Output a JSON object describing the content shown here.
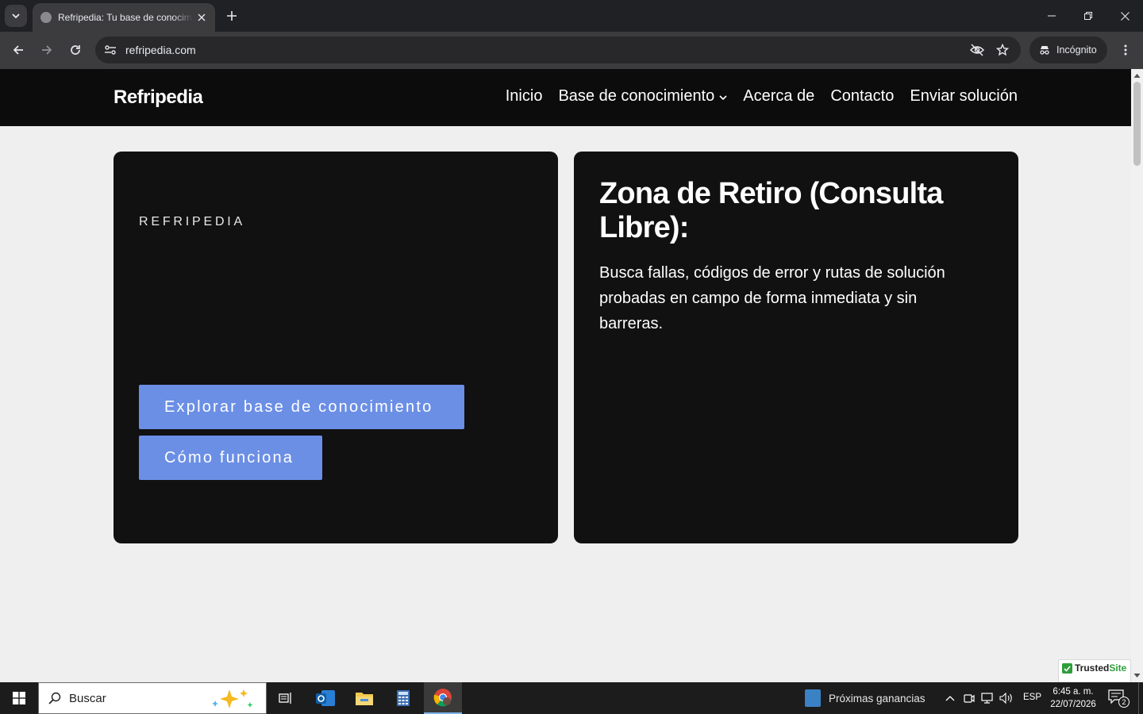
{
  "browser": {
    "tab_title": "Refripedia: Tu base de conocimiento",
    "url": "refripedia.com",
    "incognito_label": "Incógnito"
  },
  "site": {
    "brand": "Refripedia",
    "nav": [
      {
        "label": "Inicio"
      },
      {
        "label": "Base de conocimiento",
        "has_dropdown": true
      },
      {
        "label": "Acerca de"
      },
      {
        "label": "Contacto"
      },
      {
        "label": "Enviar solución"
      }
    ]
  },
  "hero_left": {
    "eyebrow": "REFRIPEDIA",
    "primary_button": "Explorar base de conocimiento",
    "secondary_button": "Cómo funciona"
  },
  "hero_right": {
    "title": "Zona de Retiro (Consulta Libre):",
    "text": "Busca fallas, códigos de error y rutas de solución probadas en campo de forma inmediata y sin barreras."
  },
  "badge": {
    "name_prefix": "Trusted",
    "name_suffix": "Site"
  },
  "taskbar": {
    "search_placeholder": "Buscar",
    "news_text": "Próximas ganancias",
    "language": "ESP",
    "time": "6:45 a. m.",
    "date": "22/07/2026",
    "notification_count": "2"
  },
  "colors": {
    "accent_button": "#6b8fe5",
    "card_bg": "#111112",
    "header_bg": "#0c0c0d",
    "page_bg": "#efefef"
  }
}
